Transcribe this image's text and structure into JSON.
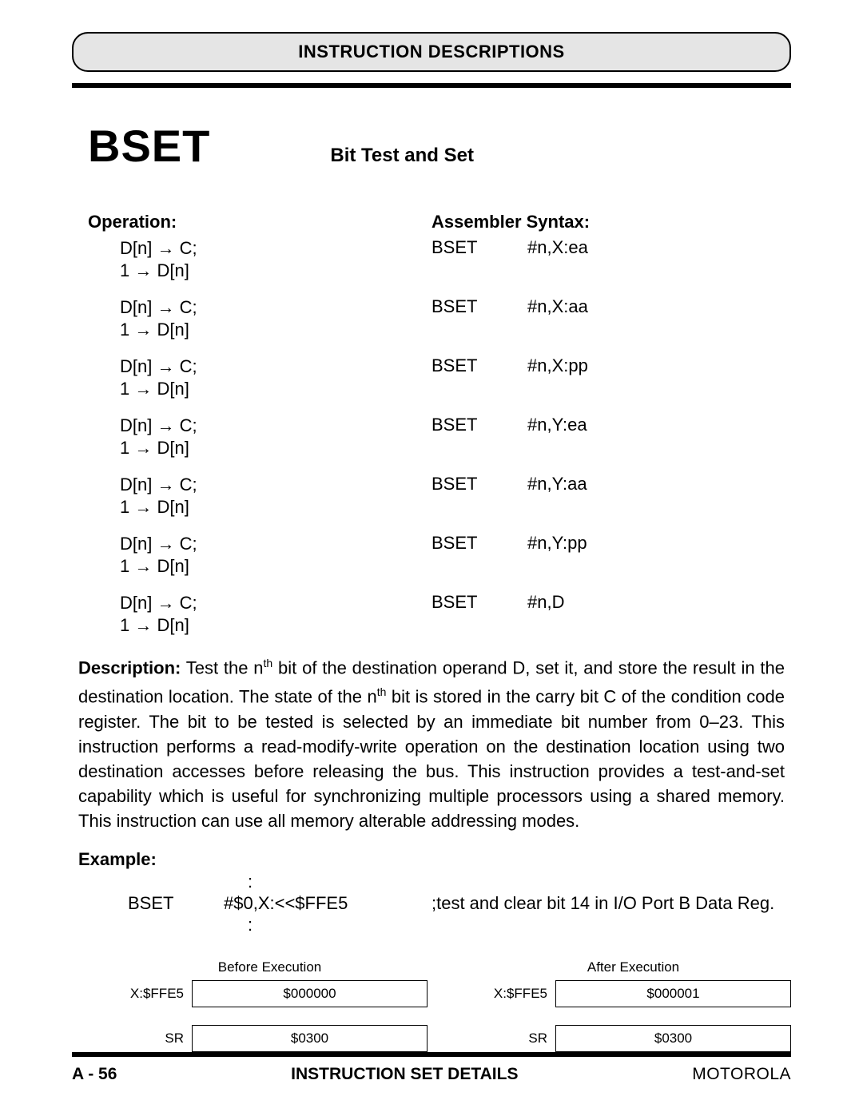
{
  "header": {
    "section_title": "INSTRUCTION DESCRIPTIONS"
  },
  "instruction": {
    "mnemonic": "BSET",
    "title": "Bit Test and Set"
  },
  "columns": {
    "operation_label": "Operation:",
    "assembler_label": "Assembler Syntax:"
  },
  "rows": [
    {
      "op1": "D[n] → C;",
      "op2": "1 → D[n]",
      "mnem": "BSET",
      "args": "#n,X:ea"
    },
    {
      "op1": "D[n] → C;",
      "op2": "1 → D[n]",
      "mnem": "BSET",
      "args": "#n,X:aa"
    },
    {
      "op1": "D[n] → C;",
      "op2": "1 → D[n]",
      "mnem": "BSET",
      "args": "#n,X:pp"
    },
    {
      "op1": "D[n] → C;",
      "op2": "1 → D[n]",
      "mnem": "BSET",
      "args": "#n,Y:ea"
    },
    {
      "op1": "D[n] → C;",
      "op2": "1 → D[n]",
      "mnem": "BSET",
      "args": "#n,Y:aa"
    },
    {
      "op1": "D[n] → C;",
      "op2": "1 → D[n]",
      "mnem": "BSET",
      "args": "#n,Y:pp"
    },
    {
      "op1": "D[n] → C;",
      "op2": "1 → D[n]",
      "mnem": "BSET",
      "args": "#n,D"
    }
  ],
  "description": {
    "label": "Description:",
    "text_part1": " Test the n",
    "sup1": "th",
    "text_part2": " bit of the destination operand D, set it, and store the result in the destination location. The state of the n",
    "sup2": "th",
    "text_part3": " bit is stored in the carry bit C of the condition code register. The bit to be tested is selected by an immediate bit number from 0–23. This instruction performs a read-modify-write operation on the destination location using two destination accesses before releasing the bus. This instruction provides a test-and-set capability which is useful for synchronizing multiple processors using a shared memory. This instruction can use all memory alterable addressing modes."
  },
  "example": {
    "label": "Example:",
    "colon": ":",
    "mnem": "BSET",
    "operand": "#$0,X:<<$FFE5",
    "comment": ";test and clear bit 14 in I/O Port B Data Reg."
  },
  "state": {
    "before_label": "Before Execution",
    "after_label": "After Execution",
    "rows": [
      {
        "label": "X:$FFE5",
        "before": "$000000",
        "after": "$000001"
      },
      {
        "label": "SR",
        "before": "$0300",
        "after": "$0300"
      }
    ]
  },
  "footer": {
    "page": "A - 56",
    "section": "INSTRUCTION SET DETAILS",
    "brand": "MOTOROLA"
  }
}
